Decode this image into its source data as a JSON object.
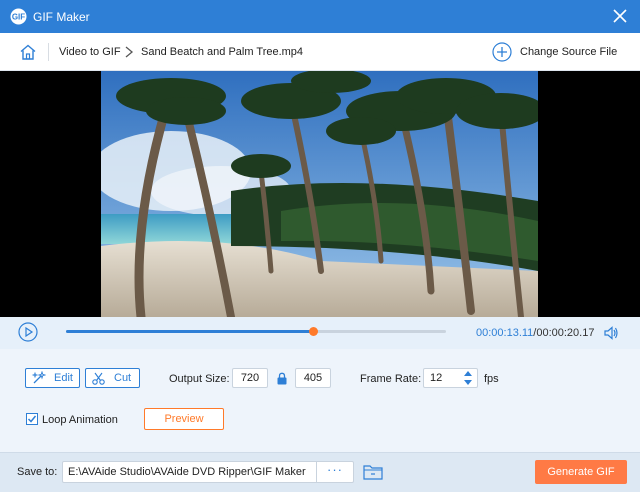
{
  "window": {
    "title": "GIF Maker"
  },
  "nav": {
    "crumb_tool": "Video to GIF",
    "crumb_file": "Sand Beatch and Palm Tree.mp4",
    "change_source_label": "Change Source File"
  },
  "player": {
    "current_time": "00:00:13.11",
    "total_time": "/00:00:20.17",
    "progress": 0.65
  },
  "settings": {
    "edit_label": "Edit",
    "cut_label": "Cut",
    "output_size_label": "Output Size:",
    "width": "720",
    "height": "405",
    "frame_rate_label": "Frame Rate:",
    "frame_rate": "12",
    "fps_label": "fps",
    "loop_label": "Loop Animation",
    "loop_checked": true,
    "preview_label": "Preview"
  },
  "save": {
    "label": "Save to:",
    "path": "E:\\AVAide Studio\\AVAide DVD Ripper\\GIF Maker",
    "browse_label": "···",
    "generate_label": "Generate GIF"
  },
  "colors": {
    "accent": "#2e7fd6",
    "orange": "#ff7a45"
  }
}
